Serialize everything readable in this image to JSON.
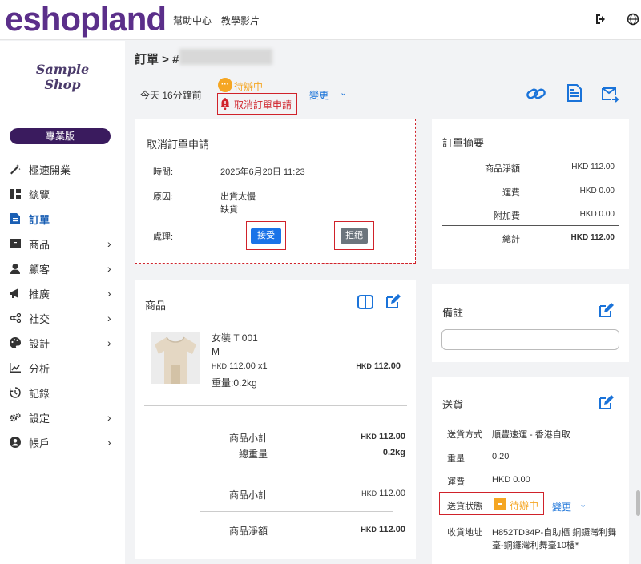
{
  "topbar": {
    "logo": "eshopland",
    "help": "幫助中心",
    "tutorial": "教學影片"
  },
  "sidebar": {
    "shop_name_line1": "Sample",
    "shop_name_line2": "Shop",
    "plan": "專業版",
    "items": [
      {
        "label": "極速開業",
        "icon": "magic-wand-icon"
      },
      {
        "label": "總覽",
        "icon": "dashboard-icon"
      },
      {
        "label": "訂單",
        "icon": "file-icon"
      },
      {
        "label": "商品",
        "icon": "box-icon"
      },
      {
        "label": "顧客",
        "icon": "user-icon"
      },
      {
        "label": "推廣",
        "icon": "megaphone-icon"
      },
      {
        "label": "社交",
        "icon": "share-icon"
      },
      {
        "label": "設計",
        "icon": "palette-icon"
      },
      {
        "label": "分析",
        "icon": "chart-icon"
      },
      {
        "label": "記錄",
        "icon": "history-icon"
      },
      {
        "label": "設定",
        "icon": "gears-icon"
      },
      {
        "label": "帳戶",
        "icon": "account-icon"
      }
    ]
  },
  "order": {
    "title": "訂單 > #",
    "time_ago": "今天 16分鐘前",
    "status": "待辦中",
    "cancel_request": "取消訂單申請",
    "change": "變更"
  },
  "cancel_card": {
    "title": "取消訂單申請",
    "time_label": "時間:",
    "time_value": "2025年6月20日 11:23",
    "reason_label": "原因:",
    "reason_line1": "出貨太慢",
    "reason_line2": "缺貨",
    "action_label": "處理:",
    "accept": "接受",
    "reject": "拒絕"
  },
  "summary": {
    "title": "訂單摘要",
    "rows": [
      {
        "label": "商品淨額",
        "value": "HKD 112.00"
      },
      {
        "label": "運費",
        "value": "HKD 0.00"
      },
      {
        "label": "附加費",
        "value": "HKD 0.00"
      }
    ],
    "total_label": "總計",
    "total_value": "HKD 112.00"
  },
  "products": {
    "title": "商品",
    "item_name": "女裝 T 001",
    "item_size": "M",
    "item_price_cur": "HKD",
    "item_price": "112.00 x1",
    "item_total_cur": "HKD",
    "item_total": "112.00",
    "item_weight": "重量:0.2kg",
    "subtotal_label": "商品小計",
    "subtotal_cur": "HKD",
    "subtotal": "112.00",
    "weight_label": "總重量",
    "weight": "0.2kg",
    "subtotal2_label": "商品小計",
    "subtotal2_cur": "HKD",
    "subtotal2": "112.00",
    "net_label": "商品淨額",
    "net_cur": "HKD",
    "net": "112.00"
  },
  "remarks": {
    "title": "備註"
  },
  "shipping": {
    "title": "送貨",
    "method_label": "送貨方式",
    "method_value": "順豐速運 - 香港自取",
    "weight_label": "重量",
    "weight_value": "0.20",
    "fee_label": "運費",
    "fee_value": "HKD 0.00",
    "status_label": "送貨狀態",
    "status_value": "待辦中",
    "change": "變更",
    "address_label": "收貨地址",
    "address_line1": "H852TD34P-自助櫃 銅鑼灣利舞",
    "address_line2": "臺-銅鑼灣利舞臺10樓*"
  },
  "colors": {
    "brand": "#5b2f8a",
    "accent": "#1a73d9",
    "alert": "#d0222a",
    "pending": "#f5a623"
  }
}
